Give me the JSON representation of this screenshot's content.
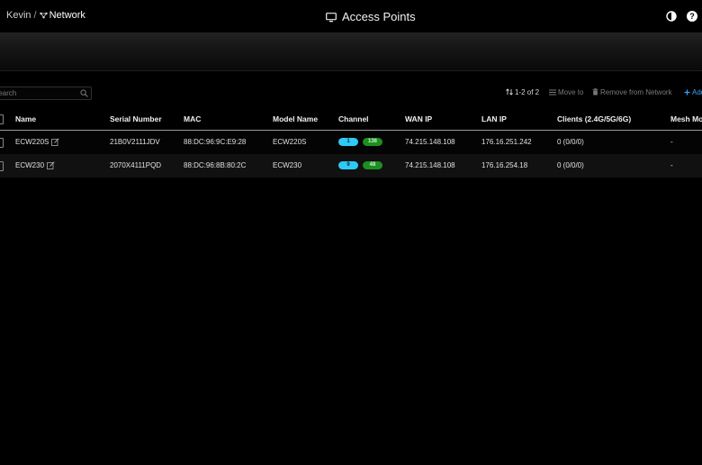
{
  "breadcrumb": {
    "org": "Kevin",
    "separator": "/",
    "network": "Network"
  },
  "page": {
    "title": "Access Points"
  },
  "search": {
    "placeholder": "Search"
  },
  "toolbar": {
    "count": "1-2 of 2",
    "move_to": "Move to",
    "remove": "Remove from Network",
    "add": "Add"
  },
  "table": {
    "headers": {
      "name": "Name",
      "serial": "Serial Number",
      "mac": "MAC",
      "model": "Model Name",
      "channel": "Channel",
      "wan": "WAN IP",
      "lan": "LAN IP",
      "clients": "Clients (2.4G/5G/6G)",
      "mesh": "Mesh Mode"
    },
    "rows": [
      {
        "name": "ECW220S",
        "serial": "21B0V2111JDV",
        "mac": "88:DC:96:9C:E9:28",
        "model": "ECW220S",
        "ch24": "1",
        "ch5": "136",
        "wan": "74.215.148.108",
        "lan": "176.16.251.242",
        "clients": "0 (0/0/0)",
        "mesh": "-"
      },
      {
        "name": "ECW230",
        "serial": "2070X4111PQD",
        "mac": "88:DC:96:8B:80:2C",
        "model": "ECW230",
        "ch24": "9",
        "ch5": "48",
        "wan": "74.215.148.108",
        "lan": "176.16.254.18",
        "clients": "0 (0/0/0)",
        "mesh": "-"
      }
    ]
  },
  "colors": {
    "accent": "#3aa0ff",
    "channel_24g": "#2ec9f5",
    "channel_5g": "#1e8e22"
  }
}
